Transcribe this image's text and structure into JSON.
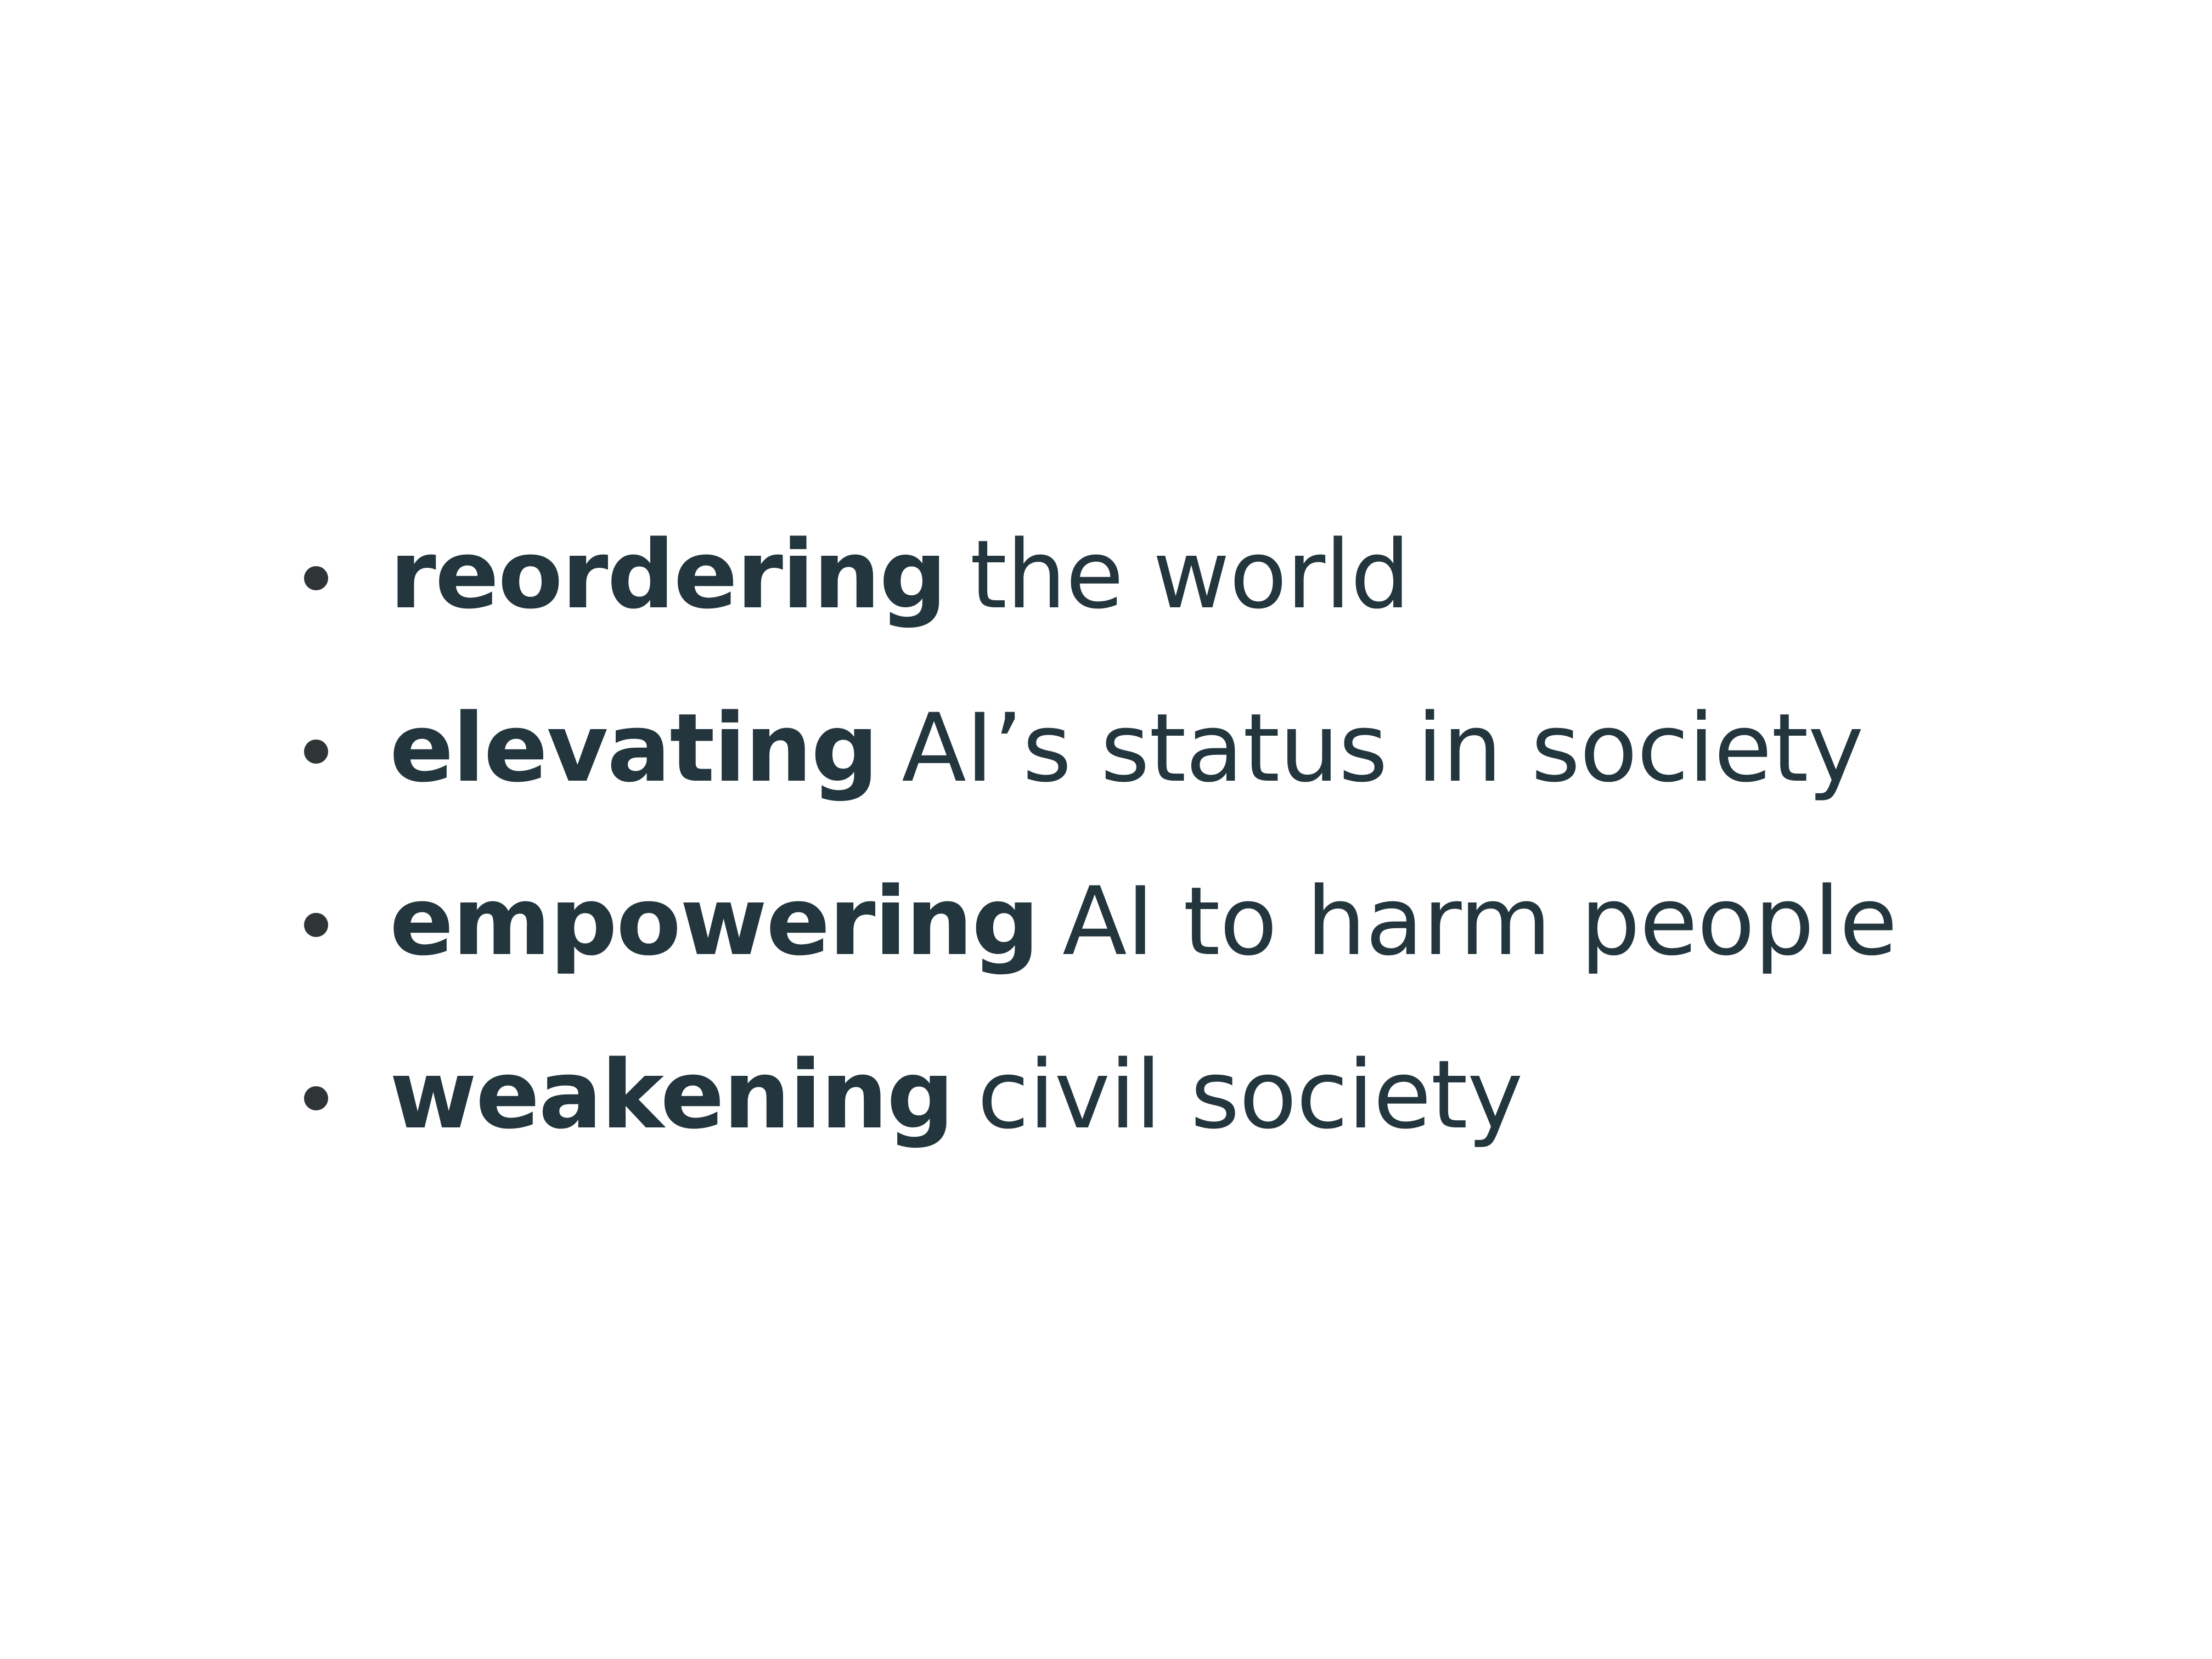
{
  "slide": {
    "bullets": [
      {
        "term": "reordering",
        "rest": "the world"
      },
      {
        "term": "elevating",
        "rest": "AI’s status in society"
      },
      {
        "term": "empowering",
        "rest": "AI to harm people"
      },
      {
        "term": "weakening",
        "rest": "civil society"
      }
    ]
  }
}
